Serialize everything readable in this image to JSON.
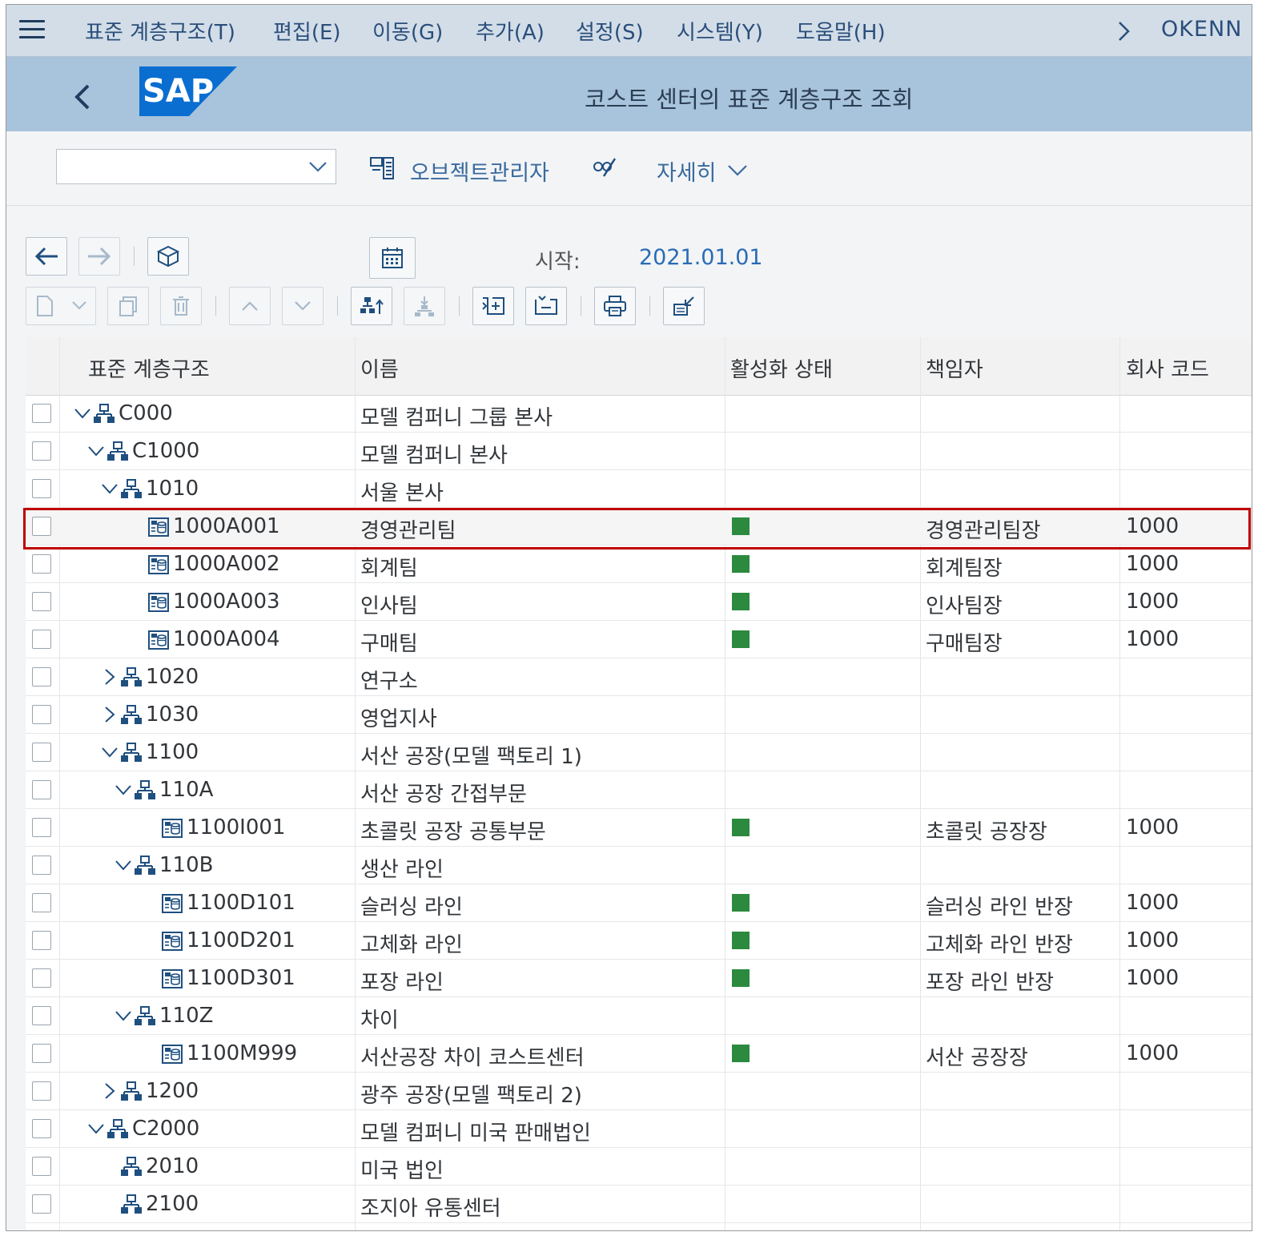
{
  "menu": {
    "items": [
      "표준 계층구조(T)",
      "편집(E)",
      "이동(G)",
      "추가(A)",
      "설정(S)",
      "시스템(Y)",
      "도움말(H)"
    ],
    "user": "OKENN"
  },
  "title": "코스트 센터의 표준 계층구조 조회",
  "logo_text": "SAP",
  "toolbar": {
    "object_manager": "오브젝트관리자",
    "more": "자세히"
  },
  "nav": {
    "start_label": "시작:",
    "start_date": "2021.01.01"
  },
  "table": {
    "headers": [
      "표준 계층구조",
      "이름",
      "활성화 상태",
      "책임자",
      "회사 코드"
    ],
    "rows": [
      {
        "id": "C000",
        "name": "모델 컴퍼니 그룹 본사",
        "manager": "",
        "company": ""
      },
      {
        "id": "C1000",
        "name": "모델 컴퍼니 본사",
        "manager": "",
        "company": ""
      },
      {
        "id": "1010",
        "name": "서울 본사",
        "manager": "",
        "company": ""
      },
      {
        "id": "1000A001",
        "name": "경영관리팀",
        "manager": "경영관리팀장",
        "company": "1000"
      },
      {
        "id": "1000A002",
        "name": "회계팀",
        "manager": "회계팀장",
        "company": "1000"
      },
      {
        "id": "1000A003",
        "name": "인사팀",
        "manager": "인사팀장",
        "company": "1000"
      },
      {
        "id": "1000A004",
        "name": "구매팀",
        "manager": "구매팀장",
        "company": "1000"
      },
      {
        "id": "1020",
        "name": "연구소",
        "manager": "",
        "company": ""
      },
      {
        "id": "1030",
        "name": "영업지사",
        "manager": "",
        "company": ""
      },
      {
        "id": "1100",
        "name": "서산 공장(모델 팩토리 1)",
        "manager": "",
        "company": ""
      },
      {
        "id": "110A",
        "name": "서산 공장 간접부문",
        "manager": "",
        "company": ""
      },
      {
        "id": "1100I001",
        "name": "초콜릿 공장 공통부문",
        "manager": "초콜릿 공장장",
        "company": "1000"
      },
      {
        "id": "110B",
        "name": "생산 라인",
        "manager": "",
        "company": ""
      },
      {
        "id": "1100D101",
        "name": "슬러싱 라인",
        "manager": "슬러싱 라인 반장",
        "company": "1000"
      },
      {
        "id": "1100D201",
        "name": "고체화 라인",
        "manager": "고체화 라인 반장",
        "company": "1000"
      },
      {
        "id": "1100D301",
        "name": "포장 라인",
        "manager": "포장 라인 반장",
        "company": "1000"
      },
      {
        "id": "110Z",
        "name": "차이",
        "manager": "",
        "company": ""
      },
      {
        "id": "1100M999",
        "name": "서산공장 차이 코스트센터",
        "manager": "서산 공장장",
        "company": "1000"
      },
      {
        "id": "1200",
        "name": "광주 공장(모델 팩토리 2)",
        "manager": "",
        "company": ""
      },
      {
        "id": "C2000",
        "name": "모델 컴퍼니 미국 판매법인",
        "manager": "",
        "company": ""
      },
      {
        "id": "2010",
        "name": "미국 법인",
        "manager": "",
        "company": ""
      },
      {
        "id": "2100",
        "name": "조지아 유통센터",
        "manager": "",
        "company": ""
      }
    ],
    "row_meta": [
      {
        "type": "group",
        "toggle": "expanded",
        "active": false
      },
      {
        "type": "group",
        "toggle": "expanded",
        "active": false
      },
      {
        "type": "group",
        "toggle": "expanded",
        "active": false
      },
      {
        "type": "cost-center",
        "toggle": "none",
        "active": true
      },
      {
        "type": "cost-center",
        "toggle": "none",
        "active": true
      },
      {
        "type": "cost-center",
        "toggle": "none",
        "active": true
      },
      {
        "type": "cost-center",
        "toggle": "none",
        "active": true
      },
      {
        "type": "group",
        "toggle": "collapsed",
        "active": false
      },
      {
        "type": "group",
        "toggle": "collapsed",
        "active": false
      },
      {
        "type": "group",
        "toggle": "expanded",
        "active": false
      },
      {
        "type": "group",
        "toggle": "expanded",
        "active": false
      },
      {
        "type": "cost-center",
        "toggle": "none",
        "active": true
      },
      {
        "type": "group",
        "toggle": "expanded",
        "active": false
      },
      {
        "type": "cost-center",
        "toggle": "none",
        "active": true
      },
      {
        "type": "cost-center",
        "toggle": "none",
        "active": true
      },
      {
        "type": "cost-center",
        "toggle": "none",
        "active": true
      },
      {
        "type": "group",
        "toggle": "expanded",
        "active": false
      },
      {
        "type": "cost-center",
        "toggle": "none",
        "active": true
      },
      {
        "type": "group",
        "toggle": "collapsed",
        "active": false
      },
      {
        "type": "group",
        "toggle": "expanded",
        "active": false
      },
      {
        "type": "group",
        "toggle": "none",
        "active": false
      },
      {
        "type": "group",
        "toggle": "none",
        "active": false
      }
    ],
    "highlighted_row_id": "1000A001"
  },
  "colors": {
    "menu_bg": "#d2dde8",
    "title_bg": "#a8c3dc",
    "status_active": "#2b8a3e",
    "highlight_border": "#c00000",
    "link": "#2a6bb5"
  },
  "icons": {
    "group": "hierarchy-node-icon",
    "cost_center": "cost-center-icon"
  }
}
